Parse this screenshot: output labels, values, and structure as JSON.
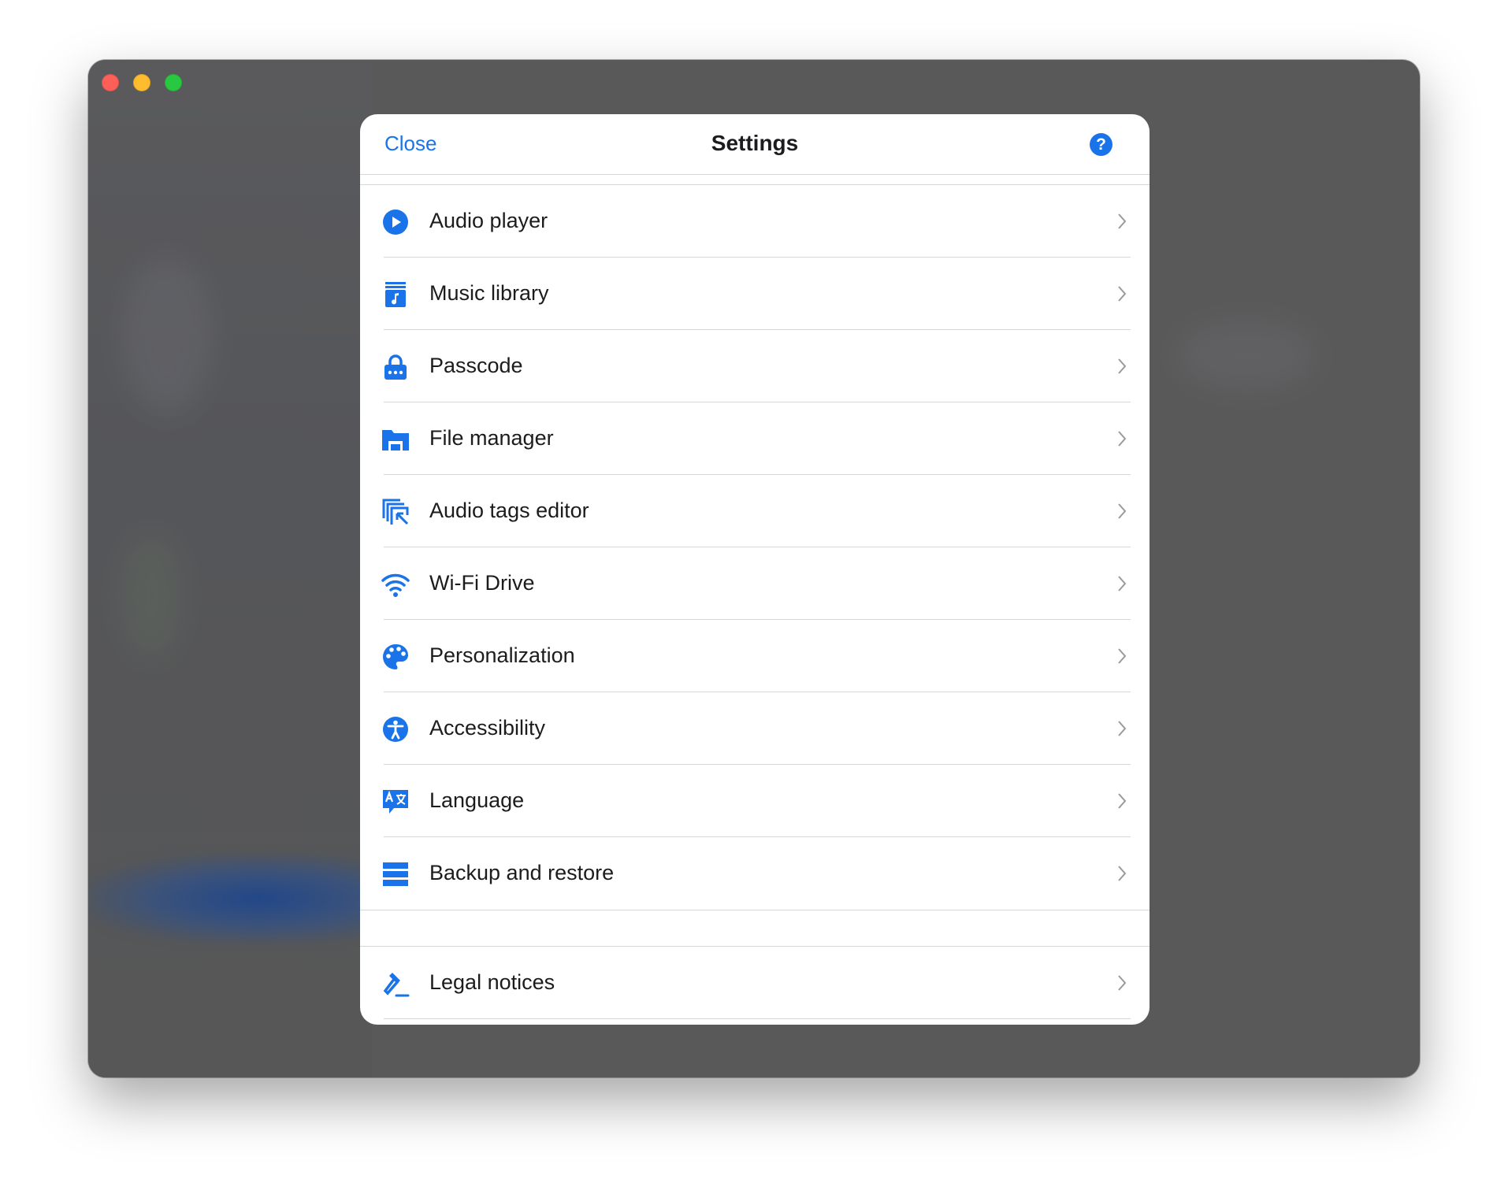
{
  "dialog": {
    "title": "Settings",
    "close_label": "Close",
    "help_label": "?"
  },
  "colors": {
    "accent": "#1a73e8",
    "window_bg": "#595959",
    "separator": "#d6d6d8"
  },
  "settings_items": [
    {
      "label": "Audio player",
      "icon": "play-circle-icon"
    },
    {
      "label": "Music library",
      "icon": "music-library-icon"
    },
    {
      "label": "Passcode",
      "icon": "lock-icon"
    },
    {
      "label": "File manager",
      "icon": "folder-icon"
    },
    {
      "label": "Audio tags editor",
      "icon": "tags-editor-icon"
    },
    {
      "label": "Wi-Fi Drive",
      "icon": "wifi-icon"
    },
    {
      "label": "Personalization",
      "icon": "palette-icon"
    },
    {
      "label": "Accessibility",
      "icon": "accessibility-icon"
    },
    {
      "label": "Language",
      "icon": "translate-icon"
    },
    {
      "label": "Backup and restore",
      "icon": "backup-icon"
    }
  ],
  "legal_items": [
    {
      "label": "Legal notices",
      "icon": "gavel-icon"
    }
  ]
}
